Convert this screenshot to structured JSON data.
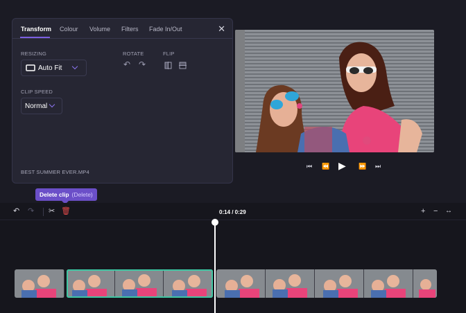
{
  "panel": {
    "tabs": [
      {
        "label": "Transform",
        "active": true
      },
      {
        "label": "Colour"
      },
      {
        "label": "Volume"
      },
      {
        "label": "Filters"
      },
      {
        "label": "Fade In/Out"
      }
    ],
    "close_icon": "close-icon",
    "resizing": {
      "label": "RESIZING",
      "value": "Auto Fit"
    },
    "rotate": {
      "label": "ROTATE"
    },
    "flip": {
      "label": "FLIP"
    },
    "clip_speed": {
      "label": "CLIP SPEED",
      "value": "Normal"
    },
    "filename": "BEST SUMMER EVER.MP4"
  },
  "tooltip": {
    "label": "Delete clip",
    "shortcut": "(Delete)"
  },
  "timeline": {
    "time": "0:14 / 0:29",
    "playhead_color": "#ffffff",
    "selection_color": "#3fc7a3",
    "accent_color": "#7c5fe0"
  }
}
